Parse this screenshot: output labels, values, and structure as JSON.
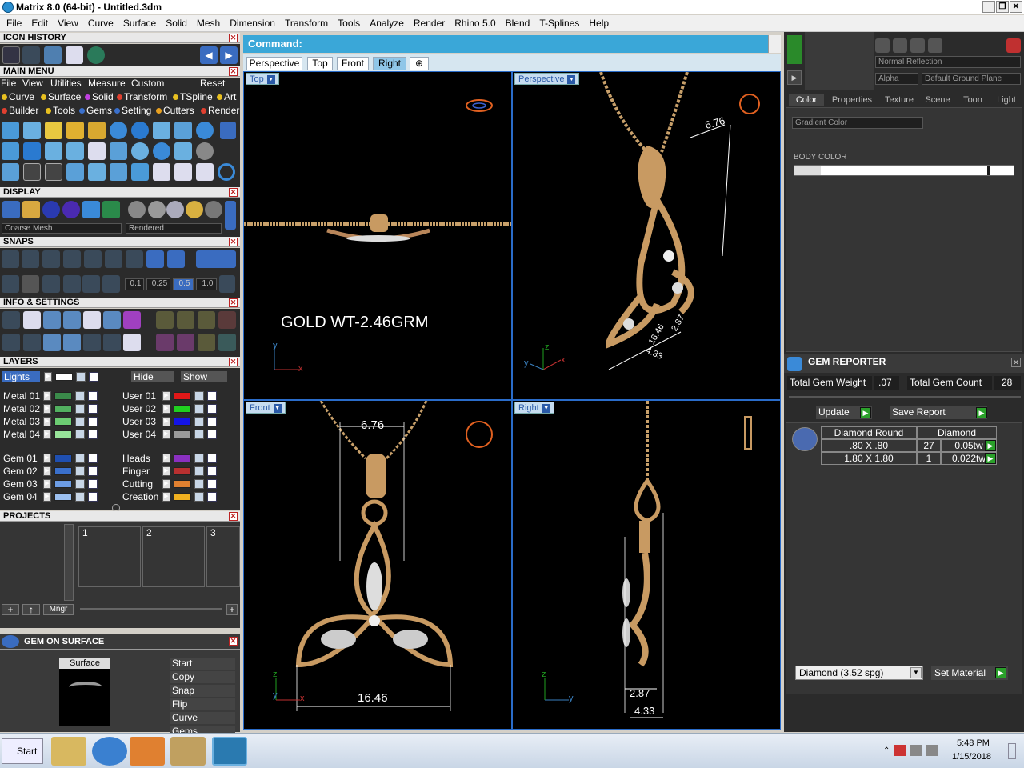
{
  "window": {
    "title": "Matrix 8.0 (64-bit) - Untitled.3dm",
    "controls": [
      "_",
      "❐",
      "✕"
    ]
  },
  "menubar": [
    "File",
    "Edit",
    "View",
    "Curve",
    "Surface",
    "Solid",
    "Mesh",
    "Dimension",
    "Transform",
    "Tools",
    "Analyze",
    "Render",
    "Rhino 5.0",
    "Blend",
    "T-Splines",
    "Help"
  ],
  "left_panel": {
    "icon_history": {
      "title": "ICON HISTORY"
    },
    "main_menu": {
      "title": "MAIN MENU",
      "row1": [
        "File",
        "View",
        "Utilities",
        "Measure",
        "Custom"
      ],
      "reset": "Reset",
      "row2": [
        "Curve",
        "Surface",
        "Solid",
        "Transform",
        "TSpline",
        "Art"
      ],
      "row3": [
        "Builder",
        "Tools",
        "Gems",
        "Setting",
        "Cutters",
        "Render"
      ]
    },
    "display": {
      "title": "DISPLAY",
      "mesh_select": "Coarse Mesh",
      "mode_select": "Rendered"
    },
    "snaps": {
      "title": "SNAPS",
      "values": [
        "0.1",
        "0.25",
        "0.5",
        "1.0"
      ]
    },
    "info": {
      "title": "INFO & SETTINGS"
    },
    "layers": {
      "title": "LAYERS",
      "lights": "Lights",
      "hide": "Hide",
      "show": "Show",
      "left": [
        {
          "name": "Metal 01",
          "color": "#3a8a4a"
        },
        {
          "name": "Metal 02",
          "color": "#52b060"
        },
        {
          "name": "Metal 03",
          "color": "#6ccc72"
        },
        {
          "name": "Metal 04",
          "color": "#98e49a"
        },
        {
          "name": "Gem 01",
          "color": "#1f4fb0"
        },
        {
          "name": "Gem 02",
          "color": "#3a70cc"
        },
        {
          "name": "Gem 03",
          "color": "#6c9ce4"
        },
        {
          "name": "Gem 04",
          "color": "#9cc0f0"
        }
      ],
      "right": [
        {
          "name": "User 01",
          "color": "#e01818"
        },
        {
          "name": "User 02",
          "color": "#20d020"
        },
        {
          "name": "User 03",
          "color": "#1414e8"
        },
        {
          "name": "User 04",
          "color": "#9a9a9a"
        },
        {
          "name": "Heads",
          "color": "#8a30c0"
        },
        {
          "name": "Finger",
          "color": "#b83030"
        },
        {
          "name": "Cutting",
          "color": "#e08030"
        },
        {
          "name": "Creation",
          "color": "#f0b020"
        }
      ]
    },
    "projects": {
      "title": "PROJECTS",
      "slots": [
        "1",
        "2",
        "3"
      ],
      "mngr": "Mngr"
    },
    "gem_on_surface": {
      "title": "GEM ON SURFACE",
      "surface_label": "Surface",
      "actions": [
        "Start",
        "Copy",
        "Snap",
        "Flip",
        "Curve",
        "Gems"
      ]
    }
  },
  "command": {
    "label": "Command:"
  },
  "view_tabs": [
    "Perspective",
    "Top",
    "Front",
    "Right"
  ],
  "active_tab": "Right",
  "viewports": {
    "top": {
      "label": "Top",
      "annotation": "GOLD WT-2.46GRM",
      "axes": [
        "y",
        "x"
      ]
    },
    "perspective": {
      "label": "Perspective",
      "dims": [
        "6.76",
        "16.46",
        "2.87",
        "4.33"
      ],
      "axes": [
        "z",
        "y",
        "x"
      ]
    },
    "front": {
      "label": "Front",
      "dims": [
        "6.76",
        "16.46"
      ],
      "axes": [
        "z",
        "y",
        "x"
      ]
    },
    "right": {
      "label": "Right",
      "dims": [
        "2.87",
        "4.33"
      ],
      "axes": [
        "z",
        "y"
      ]
    }
  },
  "right_panel": {
    "reflection": "Normal Reflection",
    "alpha": "Alpha",
    "ground": "Default Ground Plane",
    "tabs": [
      "Color",
      "Properties",
      "Texture",
      "Scene",
      "Toon",
      "Light"
    ],
    "gradient": "Gradient Color",
    "body_color": "BODY COLOR",
    "gem_reporter": {
      "title": "GEM REPORTER",
      "weight_label": "Total Gem Weight",
      "weight": ".07",
      "count_label": "Total Gem Count",
      "count": "28",
      "update": "Update",
      "save": "Save Report",
      "headers": [
        "Diamond Round",
        "Diamond"
      ],
      "rows": [
        {
          "size": ".80 X .80",
          "count": "27",
          "weight": "0.05tw"
        },
        {
          "size": "1.80 X 1.80",
          "count": "1",
          "weight": "0.022tw"
        }
      ]
    },
    "material": "Diamond    (3.52 spg)",
    "set_material": "Set Material"
  },
  "taskbar": {
    "start": "Start",
    "time": "5:48 PM",
    "date": "1/15/2018"
  }
}
